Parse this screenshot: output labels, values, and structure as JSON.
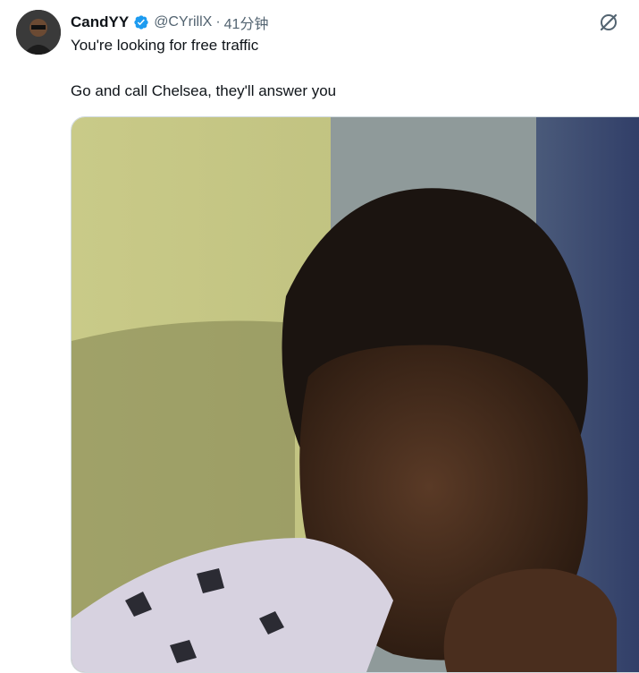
{
  "tweet": {
    "author_name": "CandYY",
    "handle": "@CYrillX",
    "separator": "·",
    "time": "41分钟",
    "lines": [
      "You're looking for free traffic",
      "Go and call Chelsea, they'll answer you"
    ]
  },
  "icons": {
    "avatar": "avatar-photo",
    "verified": "verified-badge-icon",
    "grok": "grok-icon"
  },
  "colors": {
    "text": "#0f1419",
    "secondary": "#536471",
    "verified": "#1d9bf0"
  }
}
